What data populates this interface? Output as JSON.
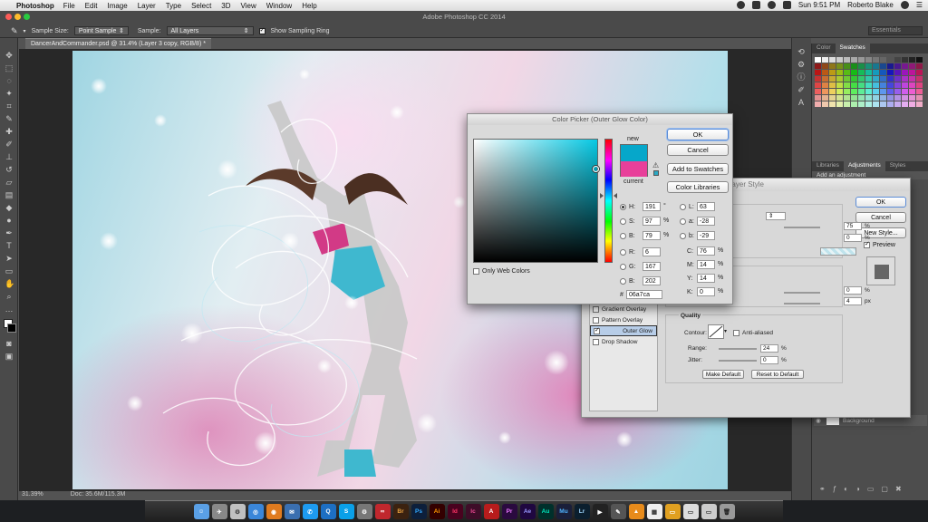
{
  "menubar": {
    "app_name": "Photoshop",
    "items": [
      "File",
      "Edit",
      "Image",
      "Layer",
      "Type",
      "Select",
      "3D",
      "View",
      "Window",
      "Help"
    ],
    "window_title": "Adobe Photoshop CC 2014",
    "clock": "Sun 9:51 PM",
    "user": "Roberto Blake"
  },
  "options": {
    "sample_size_label": "Sample Size:",
    "sample_size_value": "Point Sample",
    "sample_label": "Sample:",
    "sample_value": "All Layers",
    "show_ring_label": "Show Sampling Ring",
    "workspace": "Essentials"
  },
  "document": {
    "tab": "DancerAndCommander.psd @ 31.4% (Layer 3 copy, RGB/8) *",
    "zoom": "31.39%",
    "doc_size": "Doc: 35.6M/115.3M"
  },
  "panels": {
    "color_tabs": [
      "Color",
      "Swatches"
    ],
    "adjust_tabs": [
      "Libraries",
      "Adjustments",
      "Styles"
    ],
    "add_adjustment": "Add an adjustment",
    "layer_background": "Background"
  },
  "layer_style": {
    "title": "Layer Style",
    "ok": "OK",
    "cancel": "Cancel",
    "new_style": "New Style...",
    "preview": "Preview",
    "list": [
      {
        "label": "Gradient Overlay",
        "checked": false
      },
      {
        "label": "Pattern Overlay",
        "checked": false
      },
      {
        "label": "Outer Glow",
        "checked": true
      },
      {
        "label": "Drop Shadow",
        "checked": false
      }
    ],
    "opacity_value": "75",
    "noise_value": "0",
    "spread_value": "0",
    "size_value": "4",
    "size_unit": "px",
    "quality_label": "Quality",
    "contour_label": "Contour:",
    "anti_aliased": "Anti-aliased",
    "range_label": "Range:",
    "range_value": "24",
    "jitter_label": "Jitter:",
    "jitter_value": "0",
    "pct": "%",
    "make_default": "Make Default",
    "reset_default": "Reset to Default"
  },
  "picker": {
    "title": "Color Picker (Outer Glow Color)",
    "new_label": "new",
    "current_label": "current",
    "new_color": "#06a7ca",
    "current_color": "#e8409a",
    "ok": "OK",
    "cancel": "Cancel",
    "add_swatches": "Add to Swatches",
    "color_libraries": "Color Libraries",
    "only_web": "Only Web Colors",
    "hsb": [
      {
        "label": "H:",
        "value": "191",
        "unit": "°",
        "selected": true
      },
      {
        "label": "S:",
        "value": "97",
        "unit": "%",
        "selected": false
      },
      {
        "label": "B:",
        "value": "79",
        "unit": "%",
        "selected": false
      }
    ],
    "rgb": [
      {
        "label": "R:",
        "value": "6"
      },
      {
        "label": "G:",
        "value": "167"
      },
      {
        "label": "B:",
        "value": "202"
      }
    ],
    "lab": [
      {
        "label": "L:",
        "value": "63"
      },
      {
        "label": "a:",
        "value": "-28"
      },
      {
        "label": "b:",
        "value": "-29"
      }
    ],
    "cmyk": [
      {
        "label": "C:",
        "value": "76",
        "unit": "%"
      },
      {
        "label": "M:",
        "value": "14",
        "unit": "%"
      },
      {
        "label": "Y:",
        "value": "14",
        "unit": "%"
      },
      {
        "label": "K:",
        "value": "0",
        "unit": "%"
      }
    ],
    "hex_label": "#",
    "hex": "06a7ca"
  },
  "dock": [
    "Br",
    "Ps",
    "Ai",
    "Id",
    "Ic",
    "Pr",
    "Ae",
    "Au",
    "Mu",
    "Lr"
  ]
}
